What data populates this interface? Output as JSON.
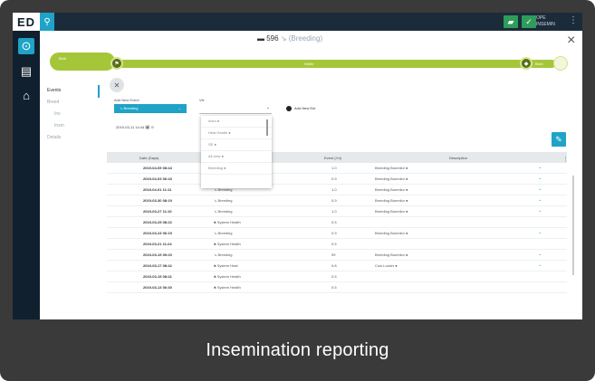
{
  "caption": "Insemination reporting",
  "colors": {
    "accent": "#1fa3c6",
    "timeline": "#a6c63a",
    "rail": "#10202e",
    "caption_bg": "#3a3a3a"
  },
  "rail": {
    "logo": "ED",
    "icons": [
      "dashboard-icon",
      "document-icon",
      "home-icon"
    ]
  },
  "topbar": {
    "search_icon": "search-icon",
    "buttons": [
      "chart-icon",
      "check-icon"
    ],
    "user_line1": "OPE",
    "user_line2": "INSEMIN",
    "kebab": "⋮"
  },
  "header": {
    "title_main": "▬ 596",
    "title_sep": "↘",
    "title_sub": "(Breeding)",
    "close": "×"
  },
  "timeline": {
    "left_label_line1": "Birth",
    "left_label_line2": "",
    "mid_label": "Heifer",
    "right_label": "Bred"
  },
  "subnav": {
    "items": [
      {
        "label": "Events",
        "active": true,
        "sub": false
      },
      {
        "label": "Breed",
        "active": false,
        "sub": false
      },
      {
        "label": "Ins",
        "active": false,
        "sub": true
      },
      {
        "label": "Insm",
        "active": false,
        "sub": true
      },
      {
        "label": "Details",
        "active": false,
        "sub": false
      }
    ]
  },
  "controls": {
    "add_new_event_label": "Add New Event",
    "event_select_value": "↘ Breeding",
    "view_label": "Vie",
    "date_value": "2019-03-11 14:44  🗓 ⊙",
    "add_new_link": "Add New Ent",
    "dropdown_options": [
      "Insm  ●",
      "Heat Health ●",
      "SE ●",
      "All view ●",
      "Breeding ●"
    ]
  },
  "table": {
    "headers": [
      "Date (Days)",
      "Event (Yd)",
      "Description"
    ],
    "rows": [
      {
        "date": "2019-04-05 08:44",
        "type": "",
        "value": "1.0",
        "desc": "Breeding Bunmilor ●",
        "chev": "⌄"
      },
      {
        "date": "2019-04-03 06:43",
        "type": "",
        "value": "0.9",
        "desc": "Breeding Bunmilor ●",
        "chev": "⌄"
      },
      {
        "date": "2019-04-01 11:11",
        "type": "↘ Breeding",
        "value": "1.0",
        "desc": "Breeding Bunmilor ●",
        "chev": "⌄"
      },
      {
        "date": "2019-03-30 08:19",
        "type": "↘ Breeding",
        "value": "0.9",
        "desc": "Breeding Bunmilor ●",
        "chev": "⌄"
      },
      {
        "date": "2019-03-27 11:10",
        "type": "↘ Breeding",
        "value": "1.0",
        "desc": "Breeding Bunmilor ●",
        "chev": "⌄"
      },
      {
        "date": "2019-03-25 08:22",
        "type": "♣ System Health",
        "value": "0.5",
        "desc": "",
        "chev": ""
      },
      {
        "date": "2019-03-23 06:15",
        "type": "↘ Breeding",
        "value": "0.9",
        "desc": "Breeding Bunmilor ●",
        "chev": "⌄"
      },
      {
        "date": "2019-03-21 11:24",
        "type": "♣ System Health",
        "value": "0.5",
        "desc": "",
        "chev": ""
      },
      {
        "date": "2019-03-19 09:20",
        "type": "↘ Breeding",
        "value": "99",
        "desc": "Breeding Bunmilor ●",
        "chev": "⌄"
      },
      {
        "date": "2019-03-17 08:42",
        "type": "♣ System Heat",
        "value": "9.8",
        "desc": "Cow Locker ●",
        "chev": "⌄"
      },
      {
        "date": "2019-03-15 08:41",
        "type": "♣ System Health",
        "value": "0.5",
        "desc": "",
        "chev": ""
      },
      {
        "date": "2019-03-13 06:30",
        "type": "♣ System Health",
        "value": "0.5",
        "desc": "",
        "chev": ""
      }
    ]
  }
}
